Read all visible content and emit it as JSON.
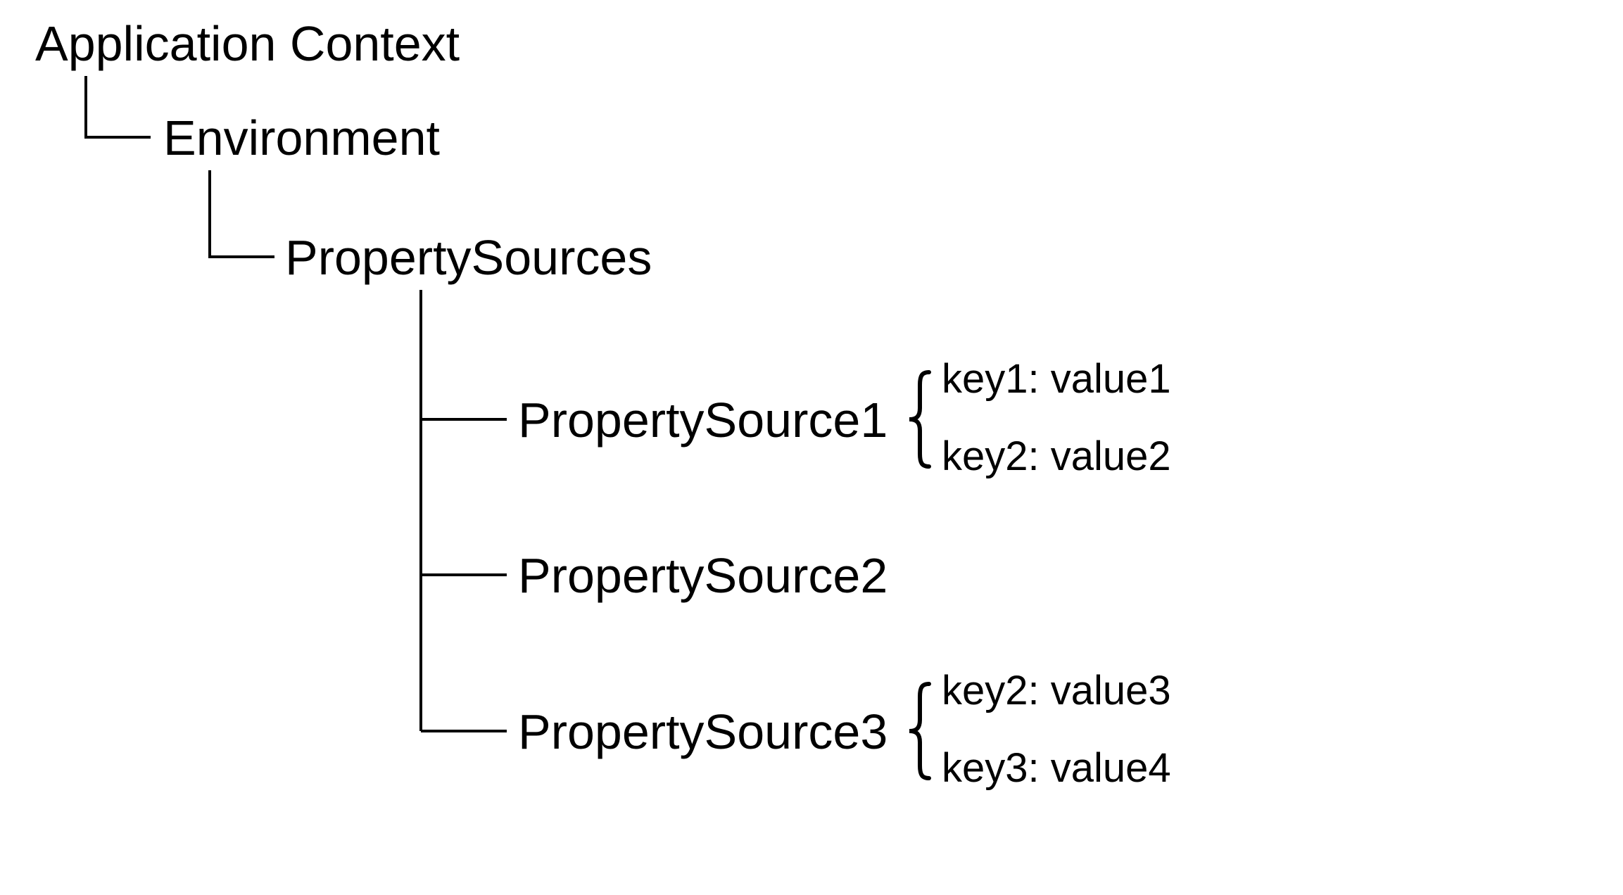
{
  "tree": {
    "root": "Application Context",
    "environment": "Environment",
    "propertySources": "PropertySources",
    "sources": [
      {
        "name": "PropertySource1",
        "entries": [
          "key1: value1",
          "key2: value2"
        ]
      },
      {
        "name": "PropertySource2",
        "entries": []
      },
      {
        "name": "PropertySource3",
        "entries": [
          "key2: value3",
          "key3: value4"
        ]
      }
    ]
  }
}
